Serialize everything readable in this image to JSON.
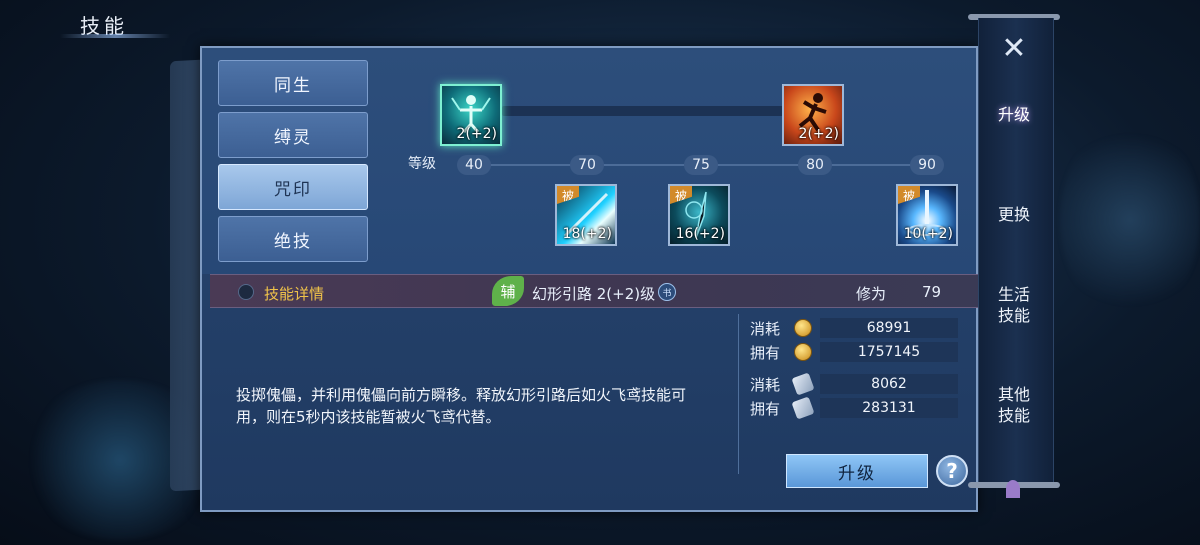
{
  "header": {
    "title": "技能"
  },
  "tabs": [
    {
      "label": "同生",
      "active": false
    },
    {
      "label": "缚灵",
      "active": false
    },
    {
      "label": "咒印",
      "active": true
    },
    {
      "label": "绝技",
      "active": false
    }
  ],
  "tree": {
    "level_label": "等级",
    "levels": [
      "40",
      "70",
      "75",
      "80",
      "90"
    ],
    "active_skills": [
      {
        "level_text": "2(+2)",
        "icon": "meditating-figure-icon",
        "selected": true
      },
      {
        "level_text": "2(+2)",
        "icon": "fire-runner-icon",
        "selected": false
      }
    ],
    "passive_skills": [
      {
        "badge": "被",
        "level_text": "18(+2)",
        "icon": "light-slash-icon"
      },
      {
        "badge": "被",
        "level_text": "16(+2)",
        "icon": "spirit-blade-icon"
      },
      {
        "badge": "被",
        "level_text": "10(+2)",
        "icon": "sword-burst-icon"
      }
    ]
  },
  "detail": {
    "label": "技能详情",
    "badge": "辅",
    "skill_name": "幻形引路 2(+2)级",
    "xiuwei_label": "修为",
    "xiuwei_value": "79",
    "description": "投掷傀儡，并利用傀儡向前方瞬移。释放幻形引路后如火飞鸢技能可用，则在5秒内该技能暂被火飞鸢代替。"
  },
  "resources": {
    "coin_cost_label": "消耗",
    "coin_cost": "68991",
    "coin_own_label": "拥有",
    "coin_own": "1757145",
    "scroll_cost_label": "消耗",
    "scroll_cost": "8062",
    "scroll_own_label": "拥有",
    "scroll_own": "283131"
  },
  "actions": {
    "upgrade": "升级",
    "help": "?"
  },
  "sidebar": {
    "close": "✕",
    "items": [
      {
        "label": "升级",
        "active": true
      },
      {
        "label": "更换",
        "active": false
      },
      {
        "label": "生活技能",
        "active": false
      },
      {
        "label": "其他技能",
        "active": false
      }
    ]
  },
  "colors": {
    "accent": "#f0c34a",
    "panel": "#24416a",
    "aux_green": "#5fb14a",
    "passive_orange": "#d28a2a"
  }
}
